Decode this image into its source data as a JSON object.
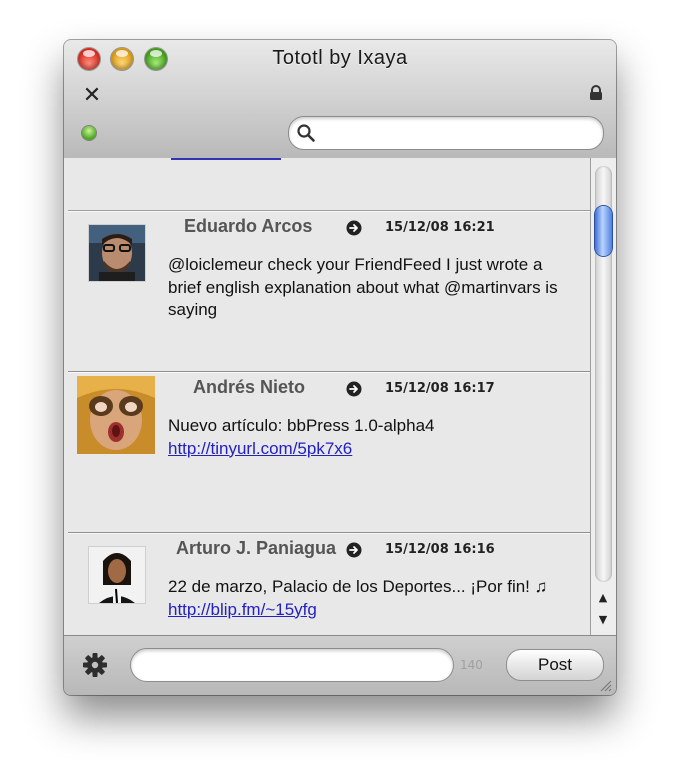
{
  "window": {
    "title": "Tototl by Ixaya"
  },
  "search": {
    "placeholder": "",
    "value": ""
  },
  "tweets": [
    {
      "author": "Eduardo Arcos",
      "date": "15/12/08 16:21",
      "text": "@loiclemeur check your FriendFeed I just wrote a brief english explanation about what @martinvars is saying",
      "link": ""
    },
    {
      "author": "Andrés Nieto",
      "date": "15/12/08 16:17",
      "text": "Nuevo artículo: bbPress 1.0-alpha4 ",
      "link": "http://tinyurl.com/5pk7x6"
    },
    {
      "author": "Arturo J. Paniagua",
      "date": "15/12/08 16:16",
      "text": "22 de marzo, Palacio de los Deportes... ¡Por fin! ♫ ",
      "link": "http://blip.fm/~15yfg"
    }
  ],
  "compose": {
    "placeholder": "",
    "counter": "140",
    "post_label": "Post"
  },
  "icons": {
    "close": "close-x-icon",
    "lock": "lock-icon",
    "status": "online-status-icon",
    "search": "search-icon",
    "reply": "arrow-right-circle-icon",
    "settings": "gear-icon",
    "resize": "resize-grip-icon"
  },
  "colors": {
    "link": "#2321c0",
    "status_green": "#4aa61c",
    "scroll_thumb": "#4f80e0"
  }
}
